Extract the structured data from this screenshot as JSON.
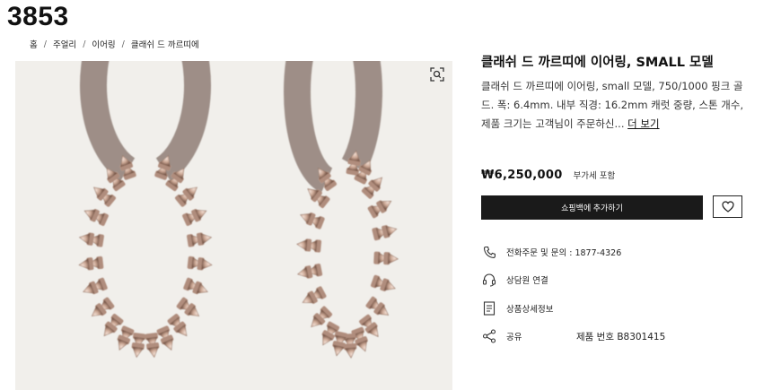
{
  "page": {
    "id_label": "3853"
  },
  "breadcrumb": {
    "items": [
      "홈",
      "주얼리",
      "이어링",
      "클래쉬 드 까르띠에"
    ],
    "separator": "/"
  },
  "product": {
    "title": "클래쉬 드 까르띠에 이어링, SMALL 모델",
    "description": "클래쉬 드 까르띠에 이어링, small 모델, 750/1000 핑크 골드. 폭: 6.4mm. 내부 직경: 16.2mm 캐럿 중량, 스톤 개수, 제품 크기는 고객님이 주문하신...",
    "more_link": "더 보기",
    "price": "₩6,250,000",
    "vat_note": "부가세 포함",
    "add_to_bag_label": "쇼핑백에 추가하기",
    "reference_label": "제품 번호 B8301415",
    "metal_color": "#c9a592"
  },
  "contact": {
    "phone": "전화주문 및 문의 : 1877-4326",
    "chat": "상담원 연결",
    "details": "상품상세정보",
    "share": "공유"
  },
  "icons": {
    "zoom": "zoom-icon",
    "wishlist": "heart-icon",
    "phone": "phone-icon",
    "chat": "headset-icon",
    "details": "document-icon",
    "share": "share-icon"
  },
  "colors": {
    "button_bg": "#1a1a1a",
    "image_bg": "#f1efeb",
    "text": "#111111"
  }
}
